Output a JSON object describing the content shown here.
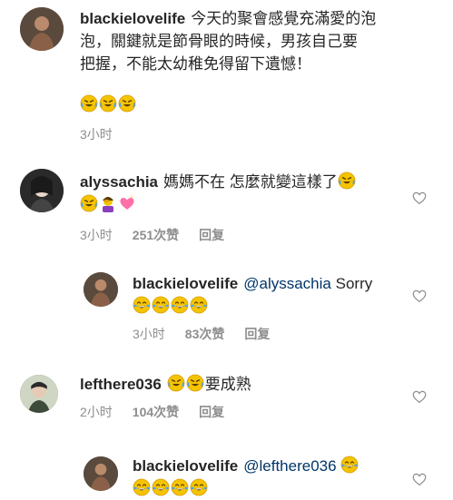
{
  "comments": [
    {
      "username": "blackielovelife",
      "text_line1": "今天的聚會感覺充滿愛的泡",
      "text_line2": "泡，關鍵就是節骨眼的時候，男孩自己要",
      "text_line3": "把握，不能太幼稚免得留下遺憾！",
      "emoji_row": "laugh-cry-emoji x3",
      "time": "3小时"
    },
    {
      "username": "alyssachia",
      "text": "媽媽不在 怎麼就變這樣了",
      "emojis": "laugh-cry-emoji, woman-facepalming-emoji, sparkling-heart-emoji",
      "time": "3小时",
      "likes": "251次赞",
      "reply": "回复"
    },
    {
      "username": "blackielovelife",
      "mention": "@alyssachia",
      "text": "Sorry",
      "emojis": "tears-of-joy-emoji x4",
      "time": "3小时",
      "likes": "83次赞",
      "reply": "回复"
    },
    {
      "username": "lefthere036",
      "text": "要成熟",
      "emojis": "laugh-cry-emoji x2",
      "time": "2小时",
      "likes": "104次赞",
      "reply": "回复"
    },
    {
      "username": "blackielovelife",
      "mention": "@lefthere036",
      "emojis": "tears-of-joy-emoji x5"
    }
  ],
  "colors": {
    "text": "#262626",
    "meta": "#8e8e8e",
    "mention": "#003569",
    "emoji_face": "#f5c400"
  }
}
